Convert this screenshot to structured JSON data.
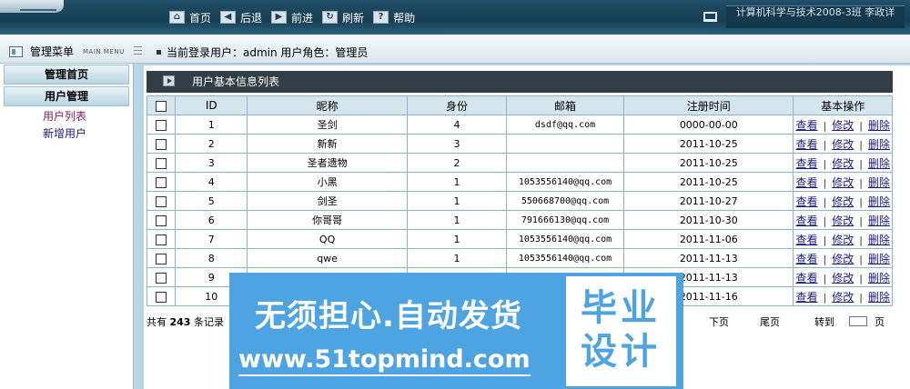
{
  "topbar": {
    "nav": [
      {
        "label": "首页",
        "icon": "home-icon"
      },
      {
        "label": "后退",
        "icon": "back-arrow-icon"
      },
      {
        "label": "前进",
        "icon": "forward-arrow-icon"
      },
      {
        "label": "刷新",
        "icon": "refresh-icon"
      },
      {
        "label": "帮助",
        "icon": "help-icon"
      }
    ],
    "school": "计算机科学与技术2008-3班   李政详"
  },
  "subbar": {
    "menu_title": "管理菜单",
    "menu_sub": "MAIN MENU",
    "user_info": "当前登录用户：admin   用户角色：管理员"
  },
  "sidebar": {
    "sections": [
      {
        "label": "管理首页"
      },
      {
        "label": "用户管理"
      }
    ],
    "links": [
      {
        "label": "用户列表",
        "active": true
      },
      {
        "label": "新增用户",
        "active": false
      }
    ]
  },
  "panel": {
    "title": "用户基本信息列表"
  },
  "table": {
    "headers": [
      "ID",
      "昵称",
      "身份",
      "邮箱",
      "注册时间",
      "基本操作"
    ],
    "ops": [
      "查看",
      "修改",
      "删除"
    ],
    "rows": [
      {
        "id": "1",
        "nick": "圣剑",
        "role": "4",
        "email": "dsdf@qq.com",
        "time": "0000-00-00"
      },
      {
        "id": "2",
        "nick": "新新",
        "role": "3",
        "email": "",
        "time": "2011-10-25"
      },
      {
        "id": "3",
        "nick": "圣者遗物",
        "role": "2",
        "email": "",
        "time": "2011-10-25"
      },
      {
        "id": "4",
        "nick": "小黑",
        "role": "1",
        "email": "1053556140@qq.com",
        "time": "2011-10-25"
      },
      {
        "id": "5",
        "nick": "剑圣",
        "role": "1",
        "email": "550668700@qq.com",
        "time": "2011-10-27"
      },
      {
        "id": "6",
        "nick": "你哥哥",
        "role": "1",
        "email": "791666130@qq.com",
        "time": "2011-10-30"
      },
      {
        "id": "7",
        "nick": "QQ",
        "role": "1",
        "email": "1053556140@qq.com",
        "time": "2011-11-06"
      },
      {
        "id": "8",
        "nick": "qwe",
        "role": "1",
        "email": "1053556140@qq.com",
        "time": "2011-11-13"
      },
      {
        "id": "9",
        "nick": "",
        "role": "",
        "email": "",
        "time": "2011-11-13"
      },
      {
        "id": "10",
        "nick": "",
        "role": "",
        "email": "",
        "time": "2011-11-16"
      }
    ]
  },
  "pager": {
    "total_prefix": "共有",
    "total_count": "243",
    "total_suffix": "条记录",
    "next": "下页",
    "last": "尾页",
    "goto": "转到",
    "page_unit": "页"
  },
  "watermark": {
    "main": "无须担心.自动发货",
    "url": "www.51topmind.com",
    "box_line1": "毕业",
    "box_line2": "设计"
  },
  "colors": {
    "topbar": "#1f4f66",
    "panel_head": "#323e45",
    "grid_border": "#8fb3c6",
    "link": "#1a1a80",
    "watermark": "#4ea4e0"
  }
}
